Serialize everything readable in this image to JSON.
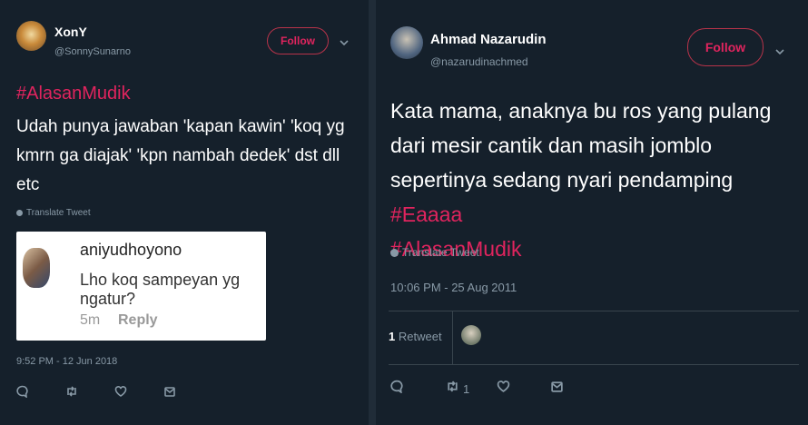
{
  "colors": {
    "background": "#15202b",
    "accent": "#e0245e",
    "muted": "#8899a6"
  },
  "tweet_left": {
    "display_name": "XonY",
    "handle": "@SonnySunarno",
    "follow_label": "Follow",
    "hashtag": "#AlasanMudik",
    "text": "Udah punya jawaban 'kapan kawin' 'koq yg kmrn ga diajak' 'kpn nambah dedek' dst dll etc",
    "translate_label": "Translate Tweet",
    "comment": {
      "name": "aniyudhoyono",
      "text": "Lho koq  sampeyan yg ngatur?",
      "time": "5m",
      "reply_label": "Reply"
    },
    "timestamp": "9:52 PM - 12 Jun 2018"
  },
  "tweet_right": {
    "display_name": "Ahmad Nazarudin",
    "handle": "@nazarudinachmed",
    "follow_label": "Follow",
    "text": "Kata mama, anaknya bu ros yang pulang dari mesir cantik dan masih jomblo sepertinya sedang nyari pendamping",
    "hashtag_1": "#Eaaaa",
    "hashtag_2": "#AlasanMudik",
    "translate_label": "Translate Tweet",
    "timestamp": "10:06 PM - 25 Aug 2011",
    "retweet_count": "1",
    "retweet_label": "Retweet",
    "retweet_action_count": "1"
  },
  "icons": [
    "reply-icon",
    "retweet-icon",
    "like-icon",
    "message-icon",
    "globe-icon",
    "chevron-down-icon"
  ]
}
